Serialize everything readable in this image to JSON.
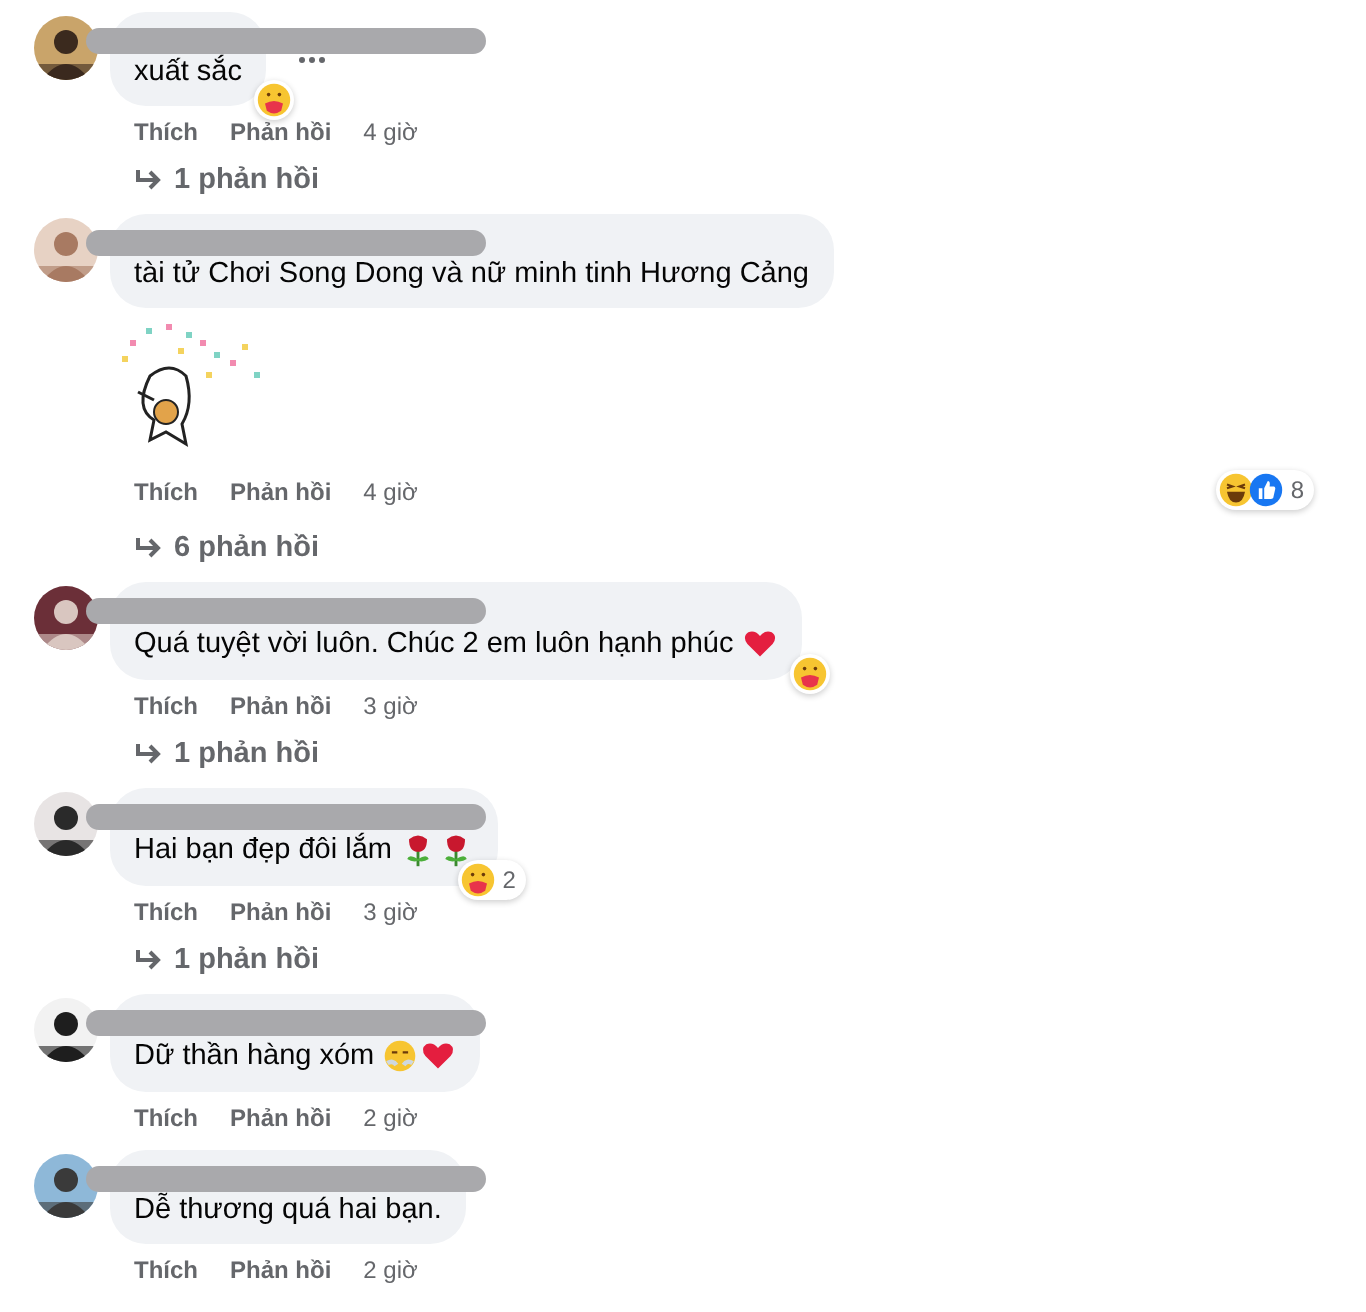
{
  "comments": [
    {
      "text": "xuất sắc",
      "more_button": true,
      "reactions": {
        "icons": [
          {
            "kind": "care"
          }
        ]
      },
      "actions": {
        "like": "Thích",
        "reply": "Phản hồi",
        "time": "4 giờ"
      },
      "replies": "1 phản hồi"
    },
    {
      "text": "tài tử Chơi Song Dong và nữ minh tinh Hương Cảng",
      "attachment": {
        "kind": "sticker"
      },
      "reactions": {
        "icons": [
          {
            "kind": "haha"
          },
          {
            "kind": "like"
          }
        ],
        "count": "8"
      },
      "actions": {
        "like": "Thích",
        "reply": "Phản hồi",
        "time": "4 giờ"
      },
      "replies": "6 phản hồi"
    },
    {
      "text": "Quá tuyệt vời luôn. Chúc 2 em luôn hạnh phúc",
      "inline_icons": [
        {
          "kind": "heart"
        }
      ],
      "reactions": {
        "icons": [
          {
            "kind": "care"
          }
        ]
      },
      "actions": {
        "like": "Thích",
        "reply": "Phản hồi",
        "time": "3 giờ"
      },
      "replies": "1 phản hồi"
    },
    {
      "text": "Hai bạn đẹp đôi lắm",
      "inline_icons": [
        {
          "kind": "rose"
        },
        {
          "kind": "rose"
        }
      ],
      "reactions": {
        "icons": [
          {
            "kind": "care"
          }
        ],
        "count": "2"
      },
      "actions": {
        "like": "Thích",
        "reply": "Phản hồi",
        "time": "3 giờ"
      },
      "replies": "1 phản hồi"
    },
    {
      "text": "Dữ thần hàng xóm",
      "inline_icons": [
        {
          "kind": "steam-face"
        },
        {
          "kind": "heart"
        }
      ],
      "actions": {
        "like": "Thích",
        "reply": "Phản hồi",
        "time": "2 giờ"
      }
    },
    {
      "text": "Dễ thương quá hai bạn.",
      "actions": {
        "like": "Thích",
        "reply": "Phản hồi",
        "time": "2 giờ"
      }
    }
  ]
}
